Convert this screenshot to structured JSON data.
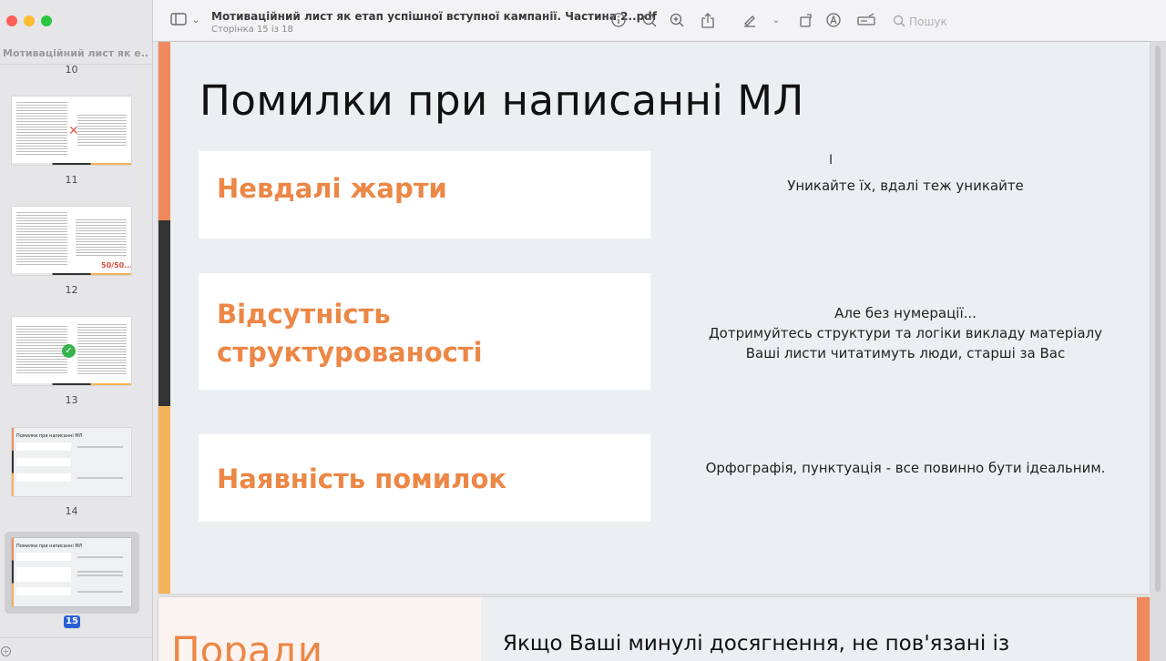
{
  "window": {
    "doc_title": "Мотиваційний лист як етап успішної вступної кампанії. Частина 2..pdf",
    "page_indicator": "Сторінка 15 із 18"
  },
  "toolbar": {
    "search_placeholder": "Пошук",
    "icons": [
      "sidebar-toggle-icon",
      "chevron-down-icon",
      "info-icon",
      "zoom-out-icon",
      "zoom-in-icon",
      "share-icon",
      "highlight-icon",
      "rotate-icon",
      "markup-icon",
      "form-icon",
      "search-icon"
    ]
  },
  "sidebar": {
    "title": "Мотиваційний лист як е...",
    "pages": [
      {
        "num": "10"
      },
      {
        "num": "11"
      },
      {
        "num": "12",
        "note": "50/50..."
      },
      {
        "num": "13"
      },
      {
        "num": "14",
        "mini_title": "Помилки при написанні МЛ"
      },
      {
        "num": "15",
        "mini_title": "Помилки при написанні МЛ"
      }
    ],
    "selected": "15"
  },
  "slide": {
    "title": "Помилки при написанні МЛ",
    "items": [
      {
        "label": "Невдалі жарти",
        "desc": [
          "Уникайте їх, вдалі теж уникайте"
        ]
      },
      {
        "label_lines": [
          "Відсутність",
          "структурованості"
        ],
        "desc": [
          "Але без нумерації...",
          "Дотримуйтесь структури та логіки викладу матеріалу",
          "Ваші листи читатимуть люди, старші за Вас"
        ]
      },
      {
        "label": "Наявність помилок",
        "desc": [
          "Орфографія, пунктуація - все повинно бути ідеальним."
        ]
      }
    ]
  },
  "next_slide": {
    "title": "Поради",
    "text": "Якщо Ваші минулі досягнення, не пов'язані із"
  },
  "colors": {
    "accent_orange": "#ec8746",
    "accent_coral": "#f08a5d",
    "accent_dark": "#333333",
    "accent_yellow": "#f3b35a"
  }
}
